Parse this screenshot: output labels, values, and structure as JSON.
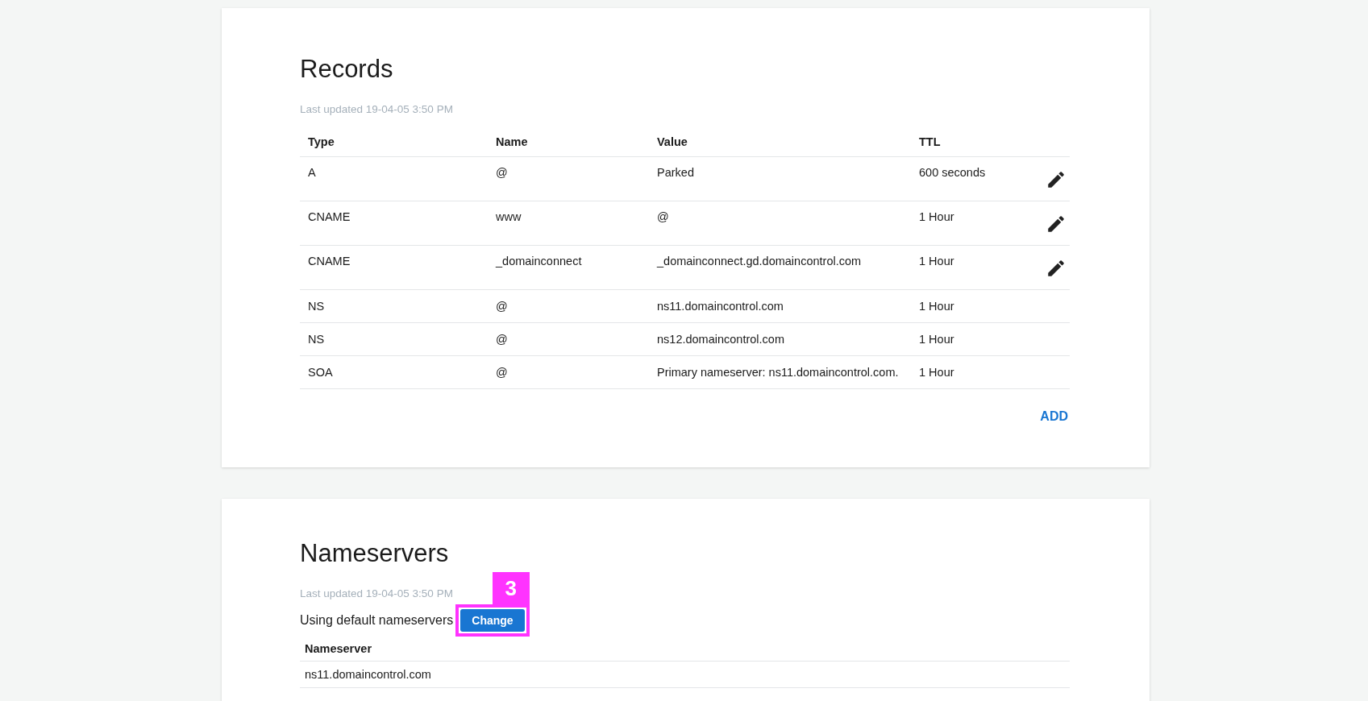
{
  "records": {
    "title": "Records",
    "last_updated": "Last updated 19-04-05 3:50 PM",
    "columns": [
      "Type",
      "Name",
      "Value",
      "TTL"
    ],
    "rows": [
      {
        "type": "A",
        "name": "@",
        "value": "Parked",
        "ttl": "600 seconds",
        "editable": true
      },
      {
        "type": "CNAME",
        "name": "www",
        "value": "@",
        "ttl": "1 Hour",
        "editable": true
      },
      {
        "type": "CNAME",
        "name": "_domainconnect",
        "value": "_domainconnect.gd.domaincontrol.com",
        "ttl": "1 Hour",
        "editable": true
      },
      {
        "type": "NS",
        "name": "@",
        "value": "ns11.domaincontrol.com",
        "ttl": "1 Hour",
        "editable": false
      },
      {
        "type": "NS",
        "name": "@",
        "value": "ns12.domaincontrol.com",
        "ttl": "1 Hour",
        "editable": false
      },
      {
        "type": "SOA",
        "name": "@",
        "value": "Primary nameserver: ns11.domaincontrol.com.",
        "ttl": "1 Hour",
        "editable": false
      }
    ],
    "add_button": "ADD"
  },
  "nameservers": {
    "title": "Nameservers",
    "last_updated": "Last updated 19-04-05 3:50 PM",
    "status": "Using default nameservers",
    "change_button": "Change",
    "callout": "3",
    "column": "Nameserver",
    "rows": [
      "ns11.domaincontrol.com"
    ]
  }
}
